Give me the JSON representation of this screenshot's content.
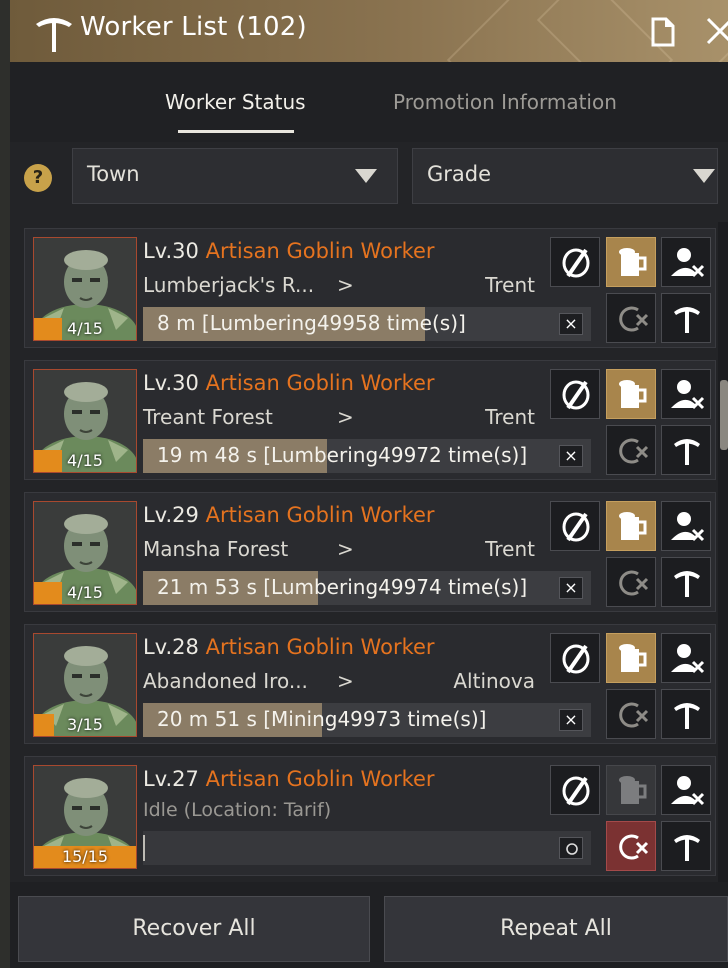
{
  "window": {
    "title": "Worker List (102)"
  },
  "tabs": [
    {
      "label": "Worker Status"
    },
    {
      "label": "Promotion Information"
    }
  ],
  "filters": {
    "help": "?",
    "town": "Town",
    "grade": "Grade"
  },
  "workers": [
    {
      "level": "Lv.30",
      "name": "Artisan Goblin Worker",
      "stamina": "4/15",
      "stamina_fraction": 0.27,
      "from": "Lumberjack's R...",
      "arrow": ">",
      "to": "Trent",
      "task": "8 m [Lumbering49958 time(s)]",
      "progress_fraction": 0.63,
      "cancel": "×",
      "repeat_active": false,
      "beer_enabled": true
    },
    {
      "level": "Lv.30",
      "name": "Artisan Goblin Worker",
      "stamina": "4/15",
      "stamina_fraction": 0.27,
      "from": "Treant Forest",
      "arrow": ">",
      "to": "Trent",
      "task": "19 m 48 s [Lumbering49972 time(s)]",
      "progress_fraction": 0.41,
      "cancel": "×",
      "repeat_active": false,
      "beer_enabled": true
    },
    {
      "level": "Lv.29",
      "name": "Artisan Goblin Worker",
      "stamina": "4/15",
      "stamina_fraction": 0.27,
      "from": "Mansha Forest",
      "arrow": ">",
      "to": "Trent",
      "task": "21 m 53 s [Lumbering49974 time(s)]",
      "progress_fraction": 0.39,
      "cancel": "×",
      "repeat_active": false,
      "beer_enabled": true
    },
    {
      "level": "Lv.28",
      "name": "Artisan Goblin Worker",
      "stamina": "3/15",
      "stamina_fraction": 0.2,
      "from": "Abandoned Iro...",
      "arrow": ">",
      "to": "Altinova",
      "task": "20 m 51 s [Mining49973 time(s)]",
      "progress_fraction": 0.4,
      "cancel": "×",
      "repeat_active": false,
      "beer_enabled": true
    },
    {
      "level": "Lv.27",
      "name": "Artisan Goblin Worker",
      "stamina": "15/15",
      "stamina_fraction": 1.0,
      "status": "Idle (Location: Tarif)",
      "repeat_active": true,
      "beer_enabled": false
    }
  ],
  "footer": {
    "recover_all": "Recover All",
    "repeat_all": "Repeat All"
  },
  "colors": {
    "accent_orange": "#e5731f",
    "title_gold": "#8a7350",
    "beer_button": "#a8854c",
    "repeat_active": "#7b3232"
  }
}
